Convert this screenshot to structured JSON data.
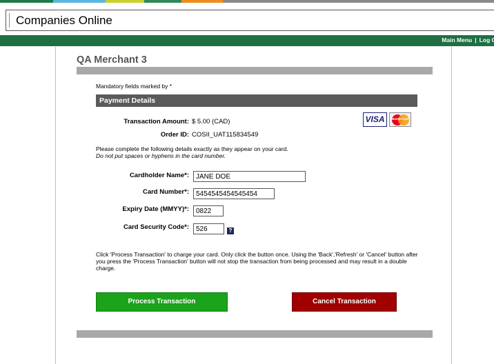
{
  "app": {
    "brand": "Companies Online"
  },
  "nav": {
    "main_menu": "Main Menu",
    "separator": "|",
    "log_off": "Log Of"
  },
  "colors": {
    "strip": [
      "#1f7a4a",
      "#5bb5e0",
      "#c8d22b",
      "#2e8b57",
      "#f08c1e"
    ],
    "nav_bar": "#1f6f43",
    "process_button": "#1ba31b",
    "cancel_button": "#a00000"
  },
  "merchant": {
    "name": "QA Merchant 3"
  },
  "form": {
    "mandatory_note": "Mandatory fields marked by *",
    "section_title": "Payment Details",
    "transaction_amount_label": "Transaction Amount:",
    "transaction_amount_value": "$ 5.00 (CAD)",
    "order_id_label": "Order ID:",
    "order_id_value": "COSII_UAT115834549",
    "instructions_line1": "Please complete the following details exactly as they appear on your card.",
    "instructions_line2": "Do not put spaces or hyphens in the card number.",
    "cardholder_label": "Cardholder Name*:",
    "cardholder_value": "JANE DOE",
    "card_number_label": "Card Number*:",
    "card_number_value": "5454545454545454",
    "expiry_label": "Expiry Date (MMYY)*:",
    "expiry_value": "0822",
    "security_label": "Card Security Code*:",
    "security_value": "526",
    "help_icon_text": "?",
    "notice": "Click 'Process Transaction' to charge your card. Only click the button once. Using the 'Back','Refresh' or 'Cancel' button after you press the 'Process Transaction' button will not stop the transaction from being processed and may result in a double charge."
  },
  "cards": {
    "visa_icon": "visa-logo",
    "visa_text": "VISA",
    "mastercard_icon": "mastercard-logo",
    "mastercard_text": "MasterCard"
  },
  "buttons": {
    "process": "Process Transaction",
    "cancel": "Cancel Transaction"
  }
}
